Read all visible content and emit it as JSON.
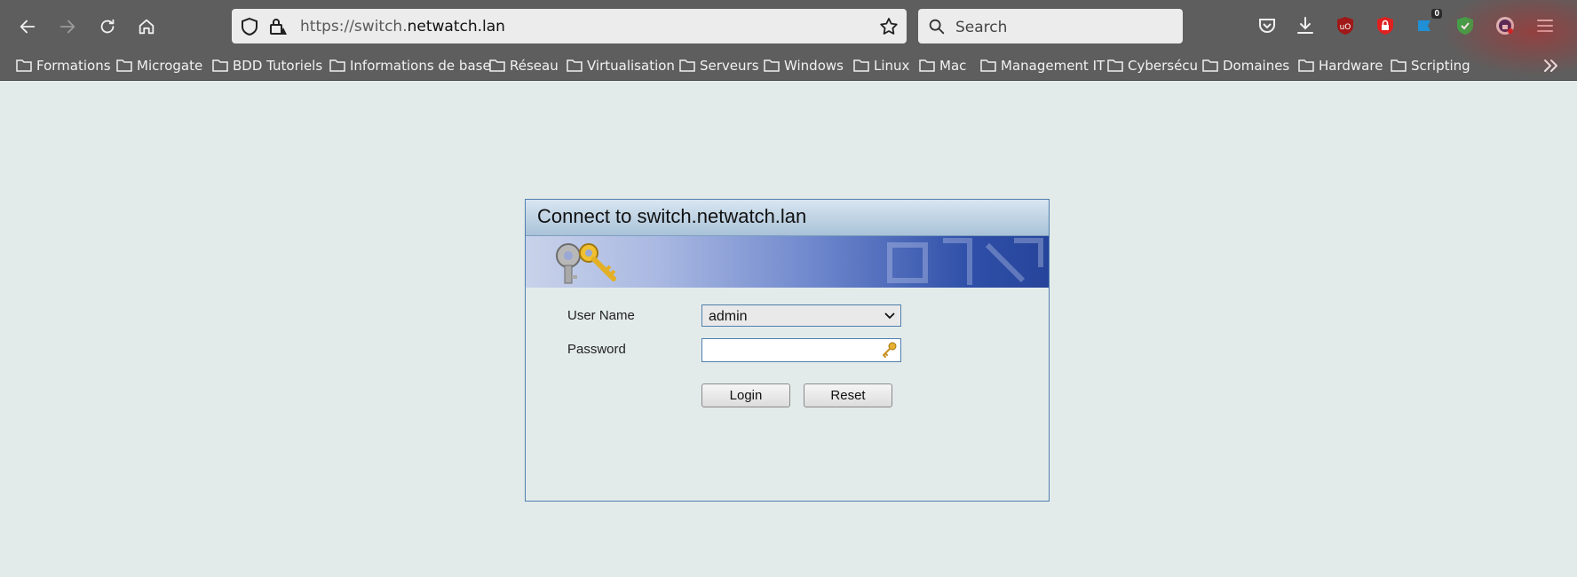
{
  "browser": {
    "url_prefix": "https://switch.",
    "url_host": "netwatch.lan",
    "search_placeholder": "Search",
    "extension_badge": "0",
    "bookmarks": [
      "Formations",
      "Microgate",
      "BDD Tutoriels",
      "Informations de base",
      "Réseau",
      "Virtualisation",
      "Serveurs",
      "Windows",
      "Linux",
      "Mac",
      "Management IT",
      "Cybersécu",
      "Domaines",
      "Hardware",
      "Scripting"
    ]
  },
  "dialog": {
    "title": "Connect to switch.netwatch.lan",
    "username_label": "User Name",
    "username_value": "admin",
    "password_label": "Password",
    "login_label": "Login",
    "reset_label": "Reset"
  }
}
